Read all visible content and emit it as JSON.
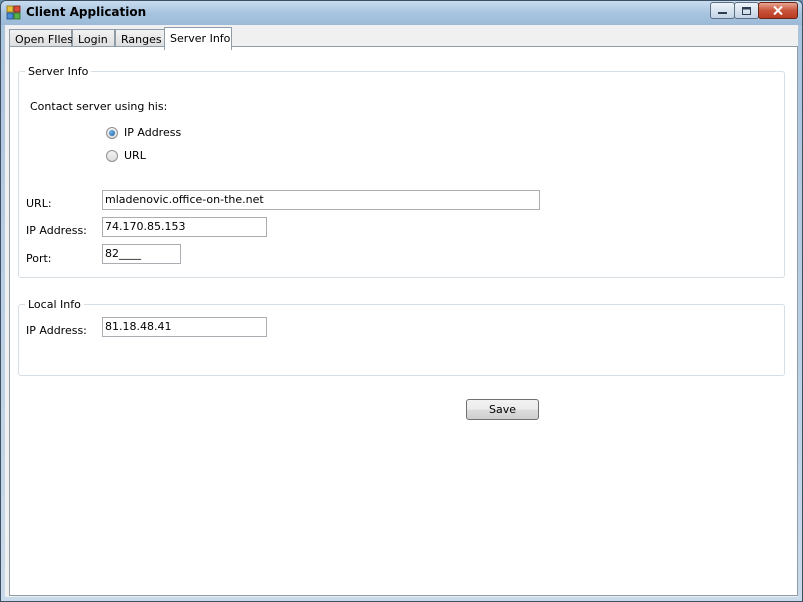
{
  "window": {
    "title": "Client Application"
  },
  "tabs": [
    {
      "label": "Open FIles"
    },
    {
      "label": "Login"
    },
    {
      "label": "Ranges"
    },
    {
      "label": "Server Info"
    }
  ],
  "server_group": {
    "legend": "Server Info",
    "contact_label": "Contact server using his:",
    "radio_ip_label": "IP Address",
    "radio_url_label": "URL",
    "selected": "IP Address",
    "url_label": "URL:",
    "url_value": "mladenovic.office-on-the.net",
    "ip_label": "IP Address:",
    "ip_value": "74.170.85.153",
    "port_label": "Port:",
    "port_value": "82____"
  },
  "local_group": {
    "legend": "Local Info",
    "ip_label": "IP Address:",
    "ip_value": "81.18.48.41"
  },
  "save_label": "Save",
  "colors": {
    "accent": "#1c5c9c",
    "close_button": "#c9543b"
  }
}
